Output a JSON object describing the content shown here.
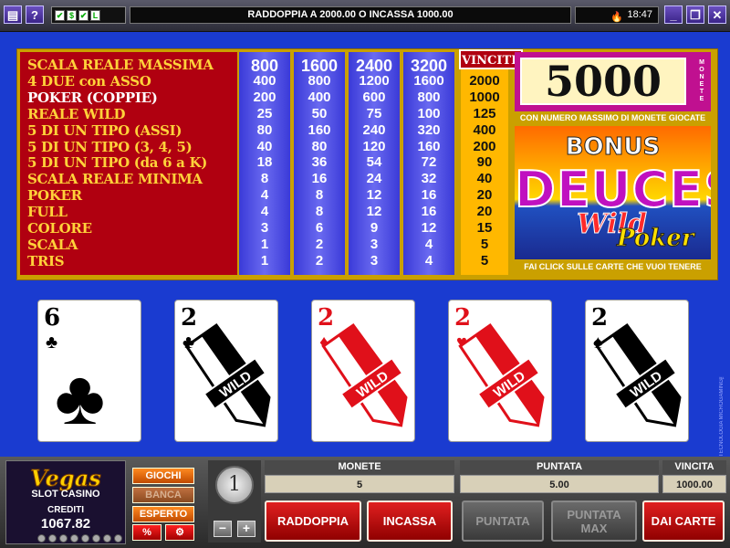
{
  "topbar": {
    "menu_icon": "menu-icon",
    "help_label": "?",
    "status_icons": [
      "✔",
      "$",
      "✔",
      "L"
    ],
    "message": "RADDOPPIA A 2000.00 O INCASSA 1000.00",
    "clock": "18:47",
    "minimize": "_",
    "restore": "❐",
    "close": "✕"
  },
  "paytable": {
    "hands": [
      "SCALA REALE MASSIMA",
      "4 DUE con ASSO",
      "POKER (COPPIE)",
      "REALE WILD",
      "5 DI UN TIPO (ASSI)",
      "5 DI UN TIPO (3, 4, 5)",
      "5 DI UN TIPO (da 6 a K)",
      "SCALA REALE MINIMA",
      "POKER",
      "FULL",
      "COLORE",
      "SCALA",
      "TRIS"
    ],
    "columns": [
      {
        "head": "800",
        "values": [
          "400",
          "200",
          "25",
          "80",
          "40",
          "18",
          "8",
          "4",
          "4",
          "3",
          "1",
          "1"
        ]
      },
      {
        "head": "1600",
        "values": [
          "800",
          "400",
          "50",
          "160",
          "80",
          "36",
          "16",
          "8",
          "8",
          "6",
          "2",
          "2"
        ]
      },
      {
        "head": "2400",
        "values": [
          "1200",
          "600",
          "75",
          "240",
          "120",
          "54",
          "24",
          "12",
          "12",
          "9",
          "3",
          "3"
        ]
      },
      {
        "head": "3200",
        "values": [
          "1600",
          "800",
          "100",
          "320",
          "160",
          "72",
          "32",
          "16",
          "16",
          "12",
          "4",
          "4"
        ]
      }
    ],
    "vincite_label": "VINCITE",
    "vincite": [
      "2000",
      "1000",
      "125",
      "400",
      "200",
      "90",
      "40",
      "20",
      "20",
      "15",
      "5",
      "5"
    ],
    "jackpot_value": "5000",
    "jackpot_unit": "MONETE",
    "max_coins_note": "CON NUMERO MASSIMO DI MONETE GIOCATE",
    "hold_hint": "FAI CLICK SULLE CARTE CHE VUOI TENERE",
    "logo": {
      "bonus": "BONUS",
      "deuces": "DEUCES",
      "wild": "Wild",
      "poker": "Poker"
    }
  },
  "cards": [
    {
      "rank": "6",
      "suit": "♣",
      "color": "black",
      "wild": false
    },
    {
      "rank": "2",
      "suit": "♣",
      "color": "black",
      "wild": true
    },
    {
      "rank": "2",
      "suit": "♦",
      "color": "red",
      "wild": true
    },
    {
      "rank": "2",
      "suit": "♥",
      "color": "red",
      "wild": true
    },
    {
      "rank": "2",
      "suit": "♠",
      "color": "black",
      "wild": true
    }
  ],
  "wild_text": "WILD",
  "side_credit": "TECNOLOGIA MICROGAMING™",
  "casino": {
    "vegas": "Vegas",
    "slot": "SLOT CASINO",
    "crediti_label": "CREDITI",
    "crediti": "1067.82"
  },
  "modes": {
    "giochi": "GIOCHI",
    "banca": "BANCA",
    "esperto": "ESPERTO",
    "percent": "%",
    "settings_icon": "⚙"
  },
  "coin": {
    "value": "1",
    "minus": "−",
    "plus": "+"
  },
  "info": {
    "monete_label": "MONETE",
    "monete": "5",
    "puntata_label": "PUNTATA",
    "puntata": "5.00",
    "vincita_label": "VINCITA",
    "vincita": "1000.00"
  },
  "actions": {
    "raddoppia": "RADDOPPIA",
    "incassa": "INCASSA",
    "puntata": "PUNTATA",
    "puntata_max": "PUNTATA MAX",
    "dai_carte": "DAI CARTE"
  },
  "colors": {
    "felt": "#1a3bd0",
    "paytable_red": "#b00010",
    "paytable_gold": "#ffb800",
    "button_red": "#c01010"
  }
}
